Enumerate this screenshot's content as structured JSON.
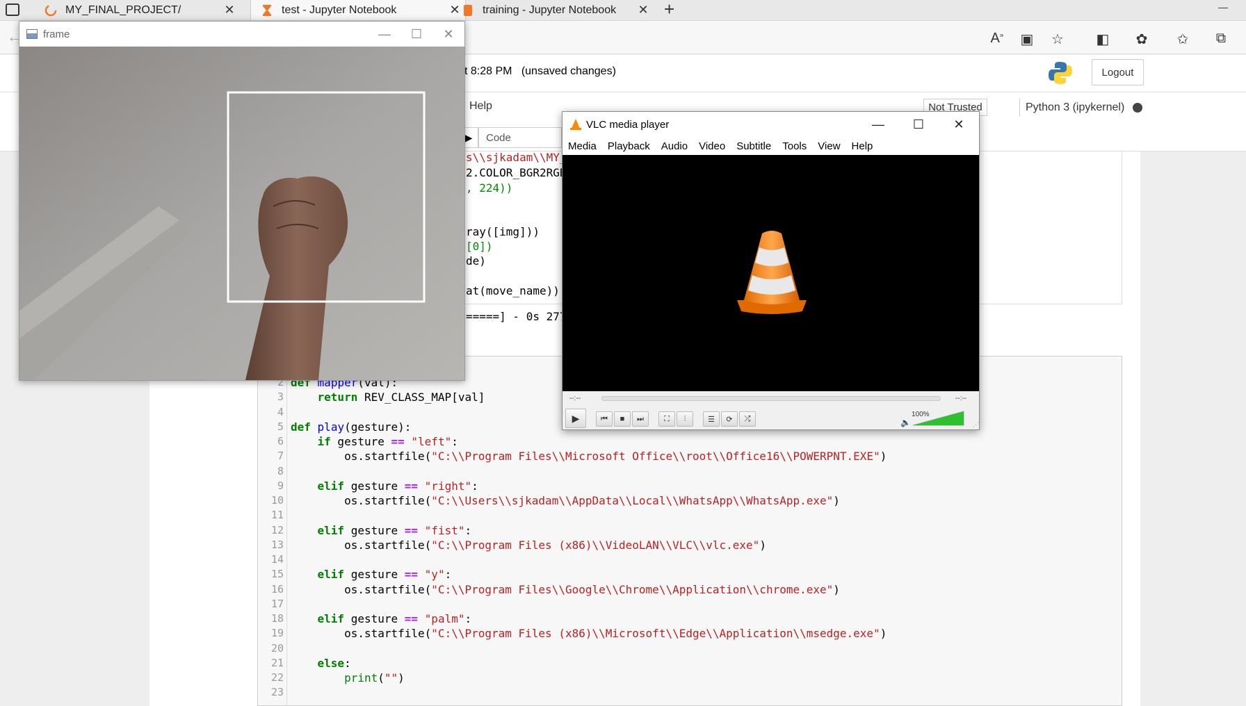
{
  "browser": {
    "tabs": [
      {
        "title": "MY_FINAL_PROJECT/",
        "icon": "loading-icon"
      },
      {
        "title": "test - Jupyter Notebook",
        "icon": "hourglass-icon"
      },
      {
        "title": "training - Jupyter Notebook",
        "icon": "notebook-icon"
      }
    ],
    "new_tab": "+",
    "minimize": "—"
  },
  "jupyter": {
    "saved_status": "t 8:28 PM   (unsaved changes)",
    "logout_label": "Logout",
    "help_menu": "Help",
    "not_trusted": "Not Trusted",
    "kernel": "Python 3 (ipykernel)",
    "cell_type": "Code"
  },
  "cell1_fragments": [
    "s\\\\sjkadam\\\\MY_",
    "2.COLOR_BGR2RGB",
    ", 224))",
    "ray([img]))",
    "[0])",
    "de)",
    "at(move_name))",
    "=====] - 0s 277"
  ],
  "cell2": {
    "line_numbers": [
      "2",
      "3",
      "4",
      "5",
      "6",
      "7",
      "8",
      "9",
      "10",
      "11",
      "12",
      "13",
      "14",
      "15",
      "16",
      "17",
      "18",
      "19",
      "20",
      "21",
      "22",
      "23"
    ]
  },
  "frame_window": {
    "title": "frame"
  },
  "vlc": {
    "title": "VLC media player",
    "menu": [
      "Media",
      "Playback",
      "Audio",
      "Video",
      "Subtitle",
      "Tools",
      "View",
      "Help"
    ],
    "time_elapsed": "--:--",
    "time_total": "--:--",
    "volume": "100%",
    "volume_level": 1.0,
    "accent_color": "#ff8800"
  }
}
